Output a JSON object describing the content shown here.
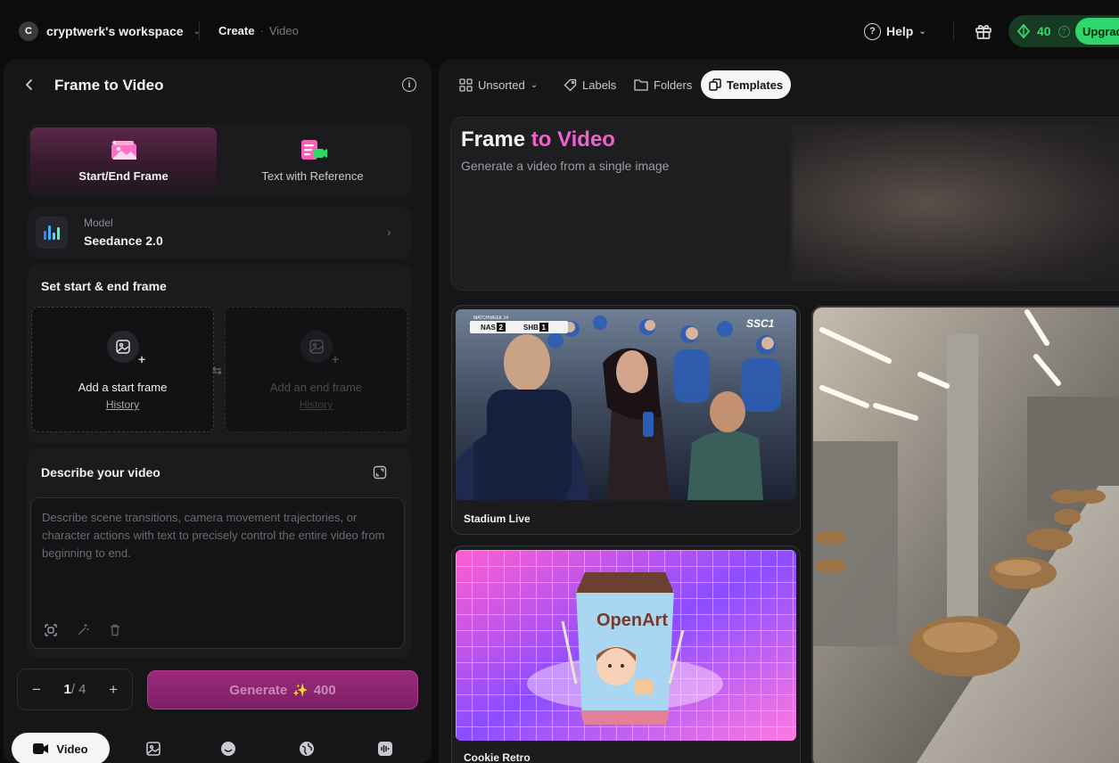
{
  "workspace": {
    "initial": "C",
    "name": "cryptwerk's workspace"
  },
  "breadcrumb": {
    "first": "Create",
    "second": "Video"
  },
  "header": {
    "help_label": "Help",
    "credits": "40",
    "upgrade_label": "Upgrade"
  },
  "panel": {
    "title": "Frame to Video",
    "modes": [
      {
        "label": "Start/End Frame"
      },
      {
        "label": "Text with Reference"
      }
    ],
    "model": {
      "label": "Model",
      "value": "Seedance 2.0"
    },
    "frames": {
      "title": "Set start & end frame",
      "start_label": "Add a start frame",
      "start_history": "History",
      "end_label": "Add an end frame",
      "end_history": "History"
    },
    "describe": {
      "title": "Describe your video",
      "placeholder": "Describe scene transitions, camera movement trajectories, or character actions with text to precisely control the entire video from beginning to end."
    },
    "quantity": {
      "current": "1",
      "max": "/ 4",
      "minus": "−",
      "plus": "+"
    },
    "generate": {
      "label": "Generate",
      "cost": "400"
    },
    "tabs": [
      {
        "label": "Video"
      }
    ]
  },
  "filters": {
    "unsorted": "Unsorted",
    "labels": "Labels",
    "folders": "Folders",
    "templates": "Templates"
  },
  "hero": {
    "title_a": "Frame",
    "title_b": " to ",
    "title_c": "Video",
    "subtitle": "Generate a video from a single image"
  },
  "cards": [
    {
      "label": "Stadium Live",
      "overlay": "SSC1",
      "score_a": "NAS",
      "score_a_val": "2",
      "score_b": "SHB",
      "score_b_val": "1",
      "matchweek": "MATCHWEEK 24"
    },
    {
      "label": "Cookie Retro",
      "brand": "OpenArt"
    }
  ],
  "colors": {
    "accent_pink": "#f25fcf",
    "credit_green": "#38d772",
    "generate": "#9a2a7c"
  }
}
